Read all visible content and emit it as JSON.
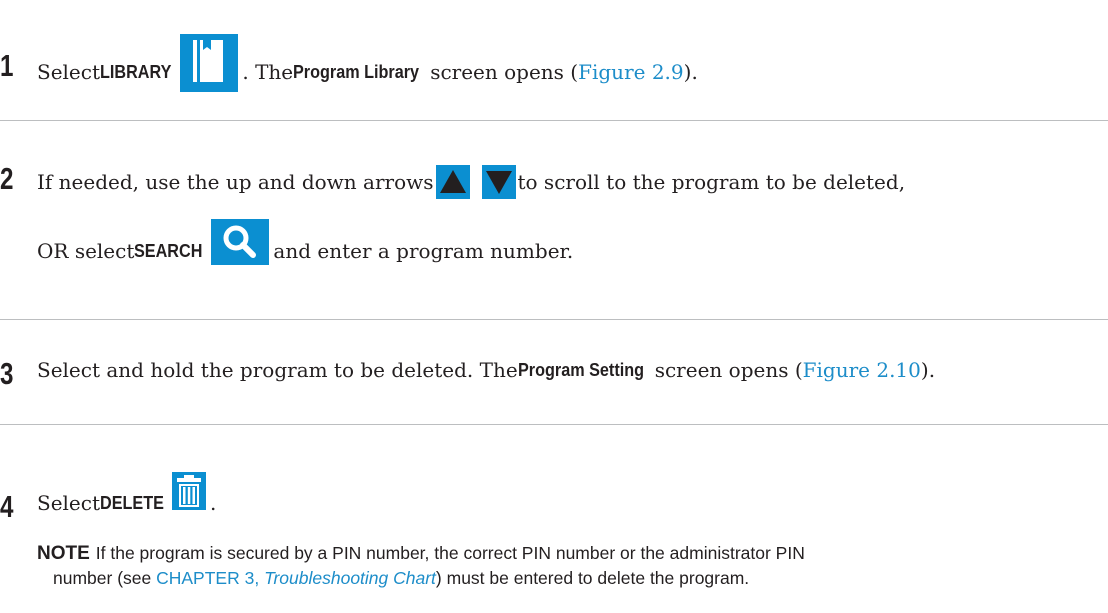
{
  "steps": [
    {
      "number": "1",
      "line1": {
        "t1": "Select ",
        "kw": "LIBRARY",
        "icon": "library-book-icon",
        "t2": ". The ",
        "kw2": "Program Library",
        "t3": " screen opens (",
        "link": "Figure 2.9",
        "t4": ")."
      }
    },
    {
      "number": "2",
      "line1": {
        "t1": "If needed, use the up and down arrows ",
        "icon_up": "up-arrow-icon",
        "icon_down": "down-arrow-icon",
        "t2": " to scroll to the program to be deleted,"
      },
      "line2": {
        "t1": "OR select ",
        "kw": "SEARCH",
        "icon": "search-magnifier-icon",
        "t2": " and enter a program number."
      }
    },
    {
      "number": "3",
      "line1": {
        "t1": "Select and hold the program to be deleted. The ",
        "kw": "Program Setting",
        "t2": " screen opens (",
        "link": "Figure 2.10",
        "t3": ")."
      }
    },
    {
      "number": "4",
      "line1": {
        "t1": "Select ",
        "kw": "DELETE",
        "icon": "trash-can-icon",
        "t2": "."
      }
    }
  ],
  "note": {
    "label": "NOTE",
    "text1": "If the program is secured by a PIN number, the correct PIN number or the administrator PIN",
    "text2a": "number (see ",
    "link_a": "CHAPTER 3, ",
    "link_b": "Troubleshooting Chart",
    "text2b": ") must be entered to delete the program."
  },
  "colors": {
    "icon_bg": "#0b8fd1",
    "link": "#1d8dc9",
    "text": "#231f20",
    "rule": "#bcbec0"
  }
}
